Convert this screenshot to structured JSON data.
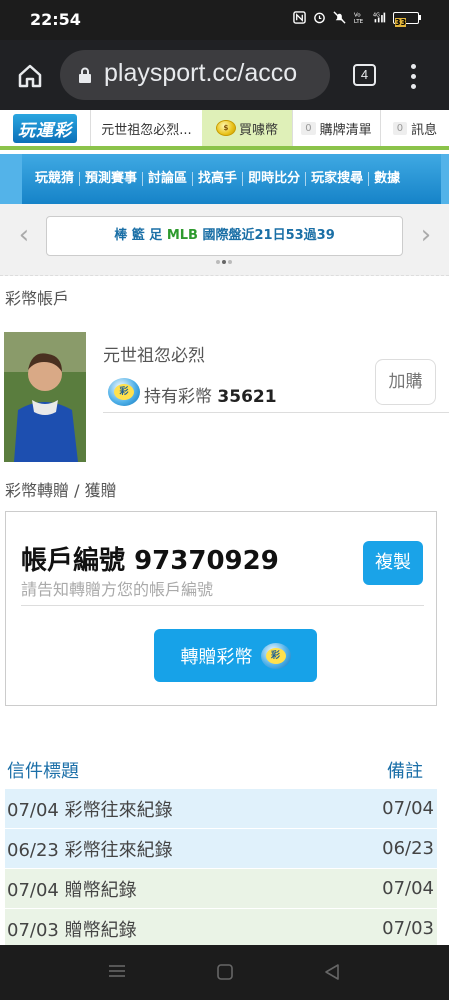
{
  "status_bar": {
    "time": "22:54",
    "battery": "33"
  },
  "browser": {
    "url": "playsport.cc/acco",
    "tab_count": "4"
  },
  "header": {
    "logo_text": "玩運彩",
    "username": "元世祖忽必烈...",
    "buy_coins": "買噱幣",
    "cart_count": "0",
    "cart_label": "購牌清單",
    "msg_count": "0",
    "msg_label": "訊息"
  },
  "nav": {
    "items": [
      "玩競猜",
      "預測賽事",
      "討論區",
      "找高手",
      "即時比分",
      "玩家搜尋",
      "數據"
    ]
  },
  "ticker": {
    "prefix": "棒 籃 足",
    "mlb": "MLB",
    "text": "國際盤近21日53過39"
  },
  "account": {
    "section_title": "彩幣帳戶",
    "name": "元世祖忽必烈",
    "holding_label": "持有彩幣",
    "holding_value": "35621",
    "buy_button": "加購"
  },
  "gift": {
    "section_title": "彩幣轉贈 / 獲贈",
    "account_label": "帳戶編號",
    "account_number": "97370929",
    "hint": "請告知轉贈方您的帳戶編號",
    "copy_button": "複製",
    "transfer_button": "轉贈彩幣"
  },
  "mail": {
    "col_title": "信件標題",
    "col_note": "備註",
    "rows": [
      {
        "title": "07/04 彩幣往來紀錄",
        "note": "07/04"
      },
      {
        "title": "06/23 彩幣往來紀錄",
        "note": "06/23"
      },
      {
        "title": "07/04 贈幣紀錄",
        "note": "07/04"
      },
      {
        "title": "07/03 贈幣紀錄",
        "note": "07/03"
      }
    ]
  },
  "colors": {
    "accent_blue": "#17a2e8",
    "nav_blue": "#1683c8",
    "header_green": "#8bc34a"
  }
}
